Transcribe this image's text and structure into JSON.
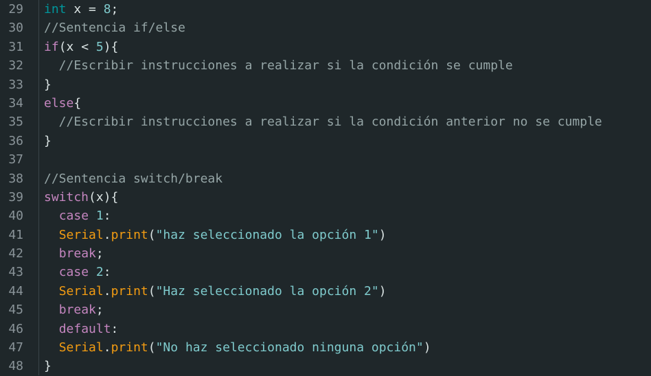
{
  "editor": {
    "line_numbers": [
      "29",
      "30",
      "31",
      "32",
      "33",
      "34",
      "35",
      "36",
      "37",
      "38",
      "39",
      "40",
      "41",
      "42",
      "43",
      "44",
      "45",
      "46",
      "47",
      "48"
    ],
    "lines": [
      [
        {
          "t": "int",
          "c": "type"
        },
        {
          "t": " x = ",
          "c": "plain"
        },
        {
          "t": "8",
          "c": "num"
        },
        {
          "t": ";",
          "c": "plain"
        }
      ],
      [
        {
          "t": "//Sentencia if/else",
          "c": "cmt"
        }
      ],
      [
        {
          "t": "if",
          "c": "kw"
        },
        {
          "t": "(x < ",
          "c": "plain"
        },
        {
          "t": "5",
          "c": "num"
        },
        {
          "t": "){",
          "c": "plain"
        }
      ],
      [
        {
          "t": "  //Escribir instrucciones a realizar si la condición se cumple",
          "c": "cmt"
        }
      ],
      [
        {
          "t": "}",
          "c": "plain"
        }
      ],
      [
        {
          "t": "else",
          "c": "kw"
        },
        {
          "t": "{",
          "c": "plain"
        }
      ],
      [
        {
          "t": "  //Escribir instrucciones a realizar si la condición anterior no se cumple",
          "c": "cmt"
        }
      ],
      [
        {
          "t": "}",
          "c": "plain"
        }
      ],
      [],
      [
        {
          "t": "//Sentencia switch/break",
          "c": "cmt"
        }
      ],
      [
        {
          "t": "switch",
          "c": "kw"
        },
        {
          "t": "(x){",
          "c": "plain"
        }
      ],
      [
        {
          "t": "  ",
          "c": "plain"
        },
        {
          "t": "case",
          "c": "kw"
        },
        {
          "t": " ",
          "c": "plain"
        },
        {
          "t": "1",
          "c": "num"
        },
        {
          "t": ":",
          "c": "plain"
        }
      ],
      [
        {
          "t": "  ",
          "c": "plain"
        },
        {
          "t": "Serial",
          "c": "cls"
        },
        {
          "t": ".",
          "c": "plain"
        },
        {
          "t": "print",
          "c": "fn"
        },
        {
          "t": "(",
          "c": "plain"
        },
        {
          "t": "\"haz seleccionado la opción 1\"",
          "c": "str"
        },
        {
          "t": ")",
          "c": "plain"
        }
      ],
      [
        {
          "t": "  ",
          "c": "plain"
        },
        {
          "t": "break",
          "c": "kw"
        },
        {
          "t": ";",
          "c": "plain"
        }
      ],
      [
        {
          "t": "  ",
          "c": "plain"
        },
        {
          "t": "case",
          "c": "kw"
        },
        {
          "t": " ",
          "c": "plain"
        },
        {
          "t": "2",
          "c": "num"
        },
        {
          "t": ":",
          "c": "plain"
        }
      ],
      [
        {
          "t": "  ",
          "c": "plain"
        },
        {
          "t": "Serial",
          "c": "cls"
        },
        {
          "t": ".",
          "c": "plain"
        },
        {
          "t": "print",
          "c": "fn"
        },
        {
          "t": "(",
          "c": "plain"
        },
        {
          "t": "\"Haz seleccionado la opción 2\"",
          "c": "str"
        },
        {
          "t": ")",
          "c": "plain"
        }
      ],
      [
        {
          "t": "  ",
          "c": "plain"
        },
        {
          "t": "break",
          "c": "kw"
        },
        {
          "t": ";",
          "c": "plain"
        }
      ],
      [
        {
          "t": "  ",
          "c": "plain"
        },
        {
          "t": "default",
          "c": "kw"
        },
        {
          "t": ":",
          "c": "plain"
        }
      ],
      [
        {
          "t": "  ",
          "c": "plain"
        },
        {
          "t": "Serial",
          "c": "cls"
        },
        {
          "t": ".",
          "c": "plain"
        },
        {
          "t": "print",
          "c": "fn"
        },
        {
          "t": "(",
          "c": "plain"
        },
        {
          "t": "\"No haz seleccionado ninguna opción\"",
          "c": "str"
        },
        {
          "t": ")",
          "c": "plain"
        }
      ],
      [
        {
          "t": "}",
          "c": "plain"
        }
      ]
    ]
  },
  "colors": {
    "background": "#1f272a",
    "line_number": "#8a9499",
    "keyword": "#c586c0",
    "type": "#00979c",
    "number": "#7fcbcd",
    "comment": "#95a5a6",
    "class": "#f39c12",
    "string": "#7fcbcd",
    "plain": "#dae3e3"
  }
}
